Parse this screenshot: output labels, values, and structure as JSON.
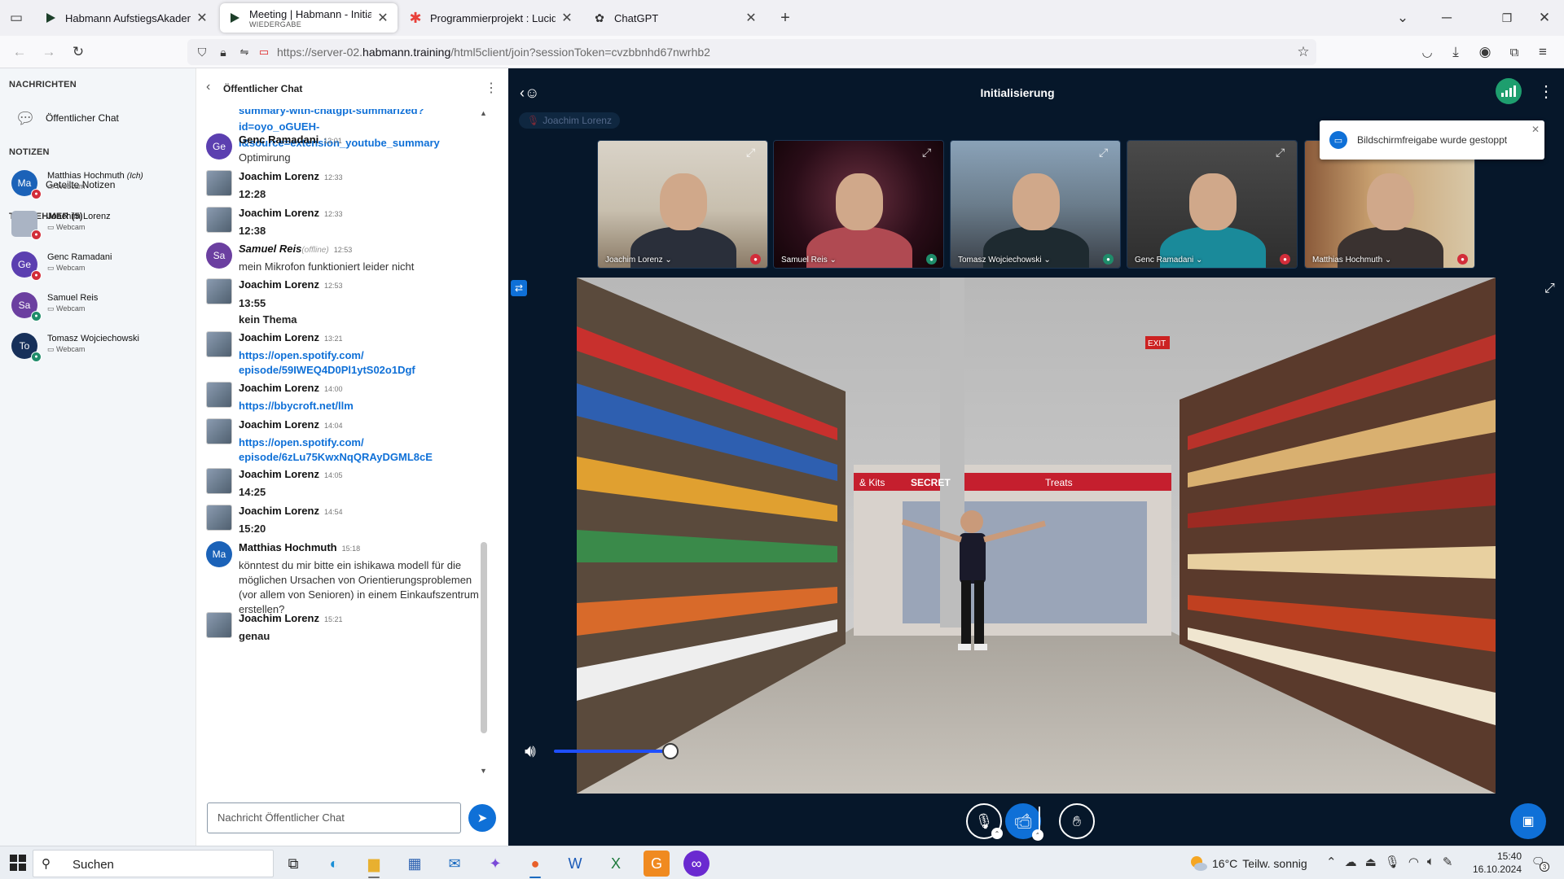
{
  "browser": {
    "tabs": [
      {
        "title": "Habmann AufstiegsAkademie",
        "subtitle": "",
        "icon": "habmann-play-icon",
        "active": false
      },
      {
        "title": "Meeting | Habmann - Initialisier",
        "subtitle": "WIEDERGABE",
        "icon": "habmann-play-icon",
        "active": true
      },
      {
        "title": "Programmierprojekt : Lucidspar",
        "subtitle": "",
        "icon": "lucid-star-icon",
        "active": false
      },
      {
        "title": "ChatGPT",
        "subtitle": "",
        "icon": "openai-icon",
        "active": false
      }
    ],
    "new_tab": "+",
    "url_prefix": "https://server-02.",
    "url_domain": "habmann.training",
    "url_path": "/html5client/join?sessionToken=cvzbbnhd67nwrhb2"
  },
  "left_panel": {
    "messages_heading": "NACHRICHTEN",
    "public_chat_label": "Öffentlicher Chat",
    "notes_heading": "NOTIZEN",
    "shared_notes_label": "Geteilte Notizen",
    "participants_heading": "TEILNEHMER (5)",
    "participants": [
      {
        "name": "Matthias Hochmuth",
        "tag": "(Ich)",
        "initials": "Ma",
        "role": "Webcam",
        "color": "#1b62b8",
        "mic": "muted",
        "photo": false
      },
      {
        "name": "Joachim Lorenz",
        "tag": "",
        "initials": "",
        "role": "Webcam",
        "color": "#aab4c4",
        "mic": "muted",
        "photo": true
      },
      {
        "name": "Genc Ramadani",
        "tag": "",
        "initials": "Ge",
        "role": "Webcam",
        "color": "#5b3fb0",
        "mic": "muted",
        "photo": false
      },
      {
        "name": "Samuel Reis",
        "tag": "",
        "initials": "Sa",
        "role": "Webcam",
        "color": "#6b3fa0",
        "mic": "on",
        "photo": false
      },
      {
        "name": "Tomasz Wojciechowski",
        "tag": "",
        "initials": "To",
        "role": "Webcam",
        "color": "#17305a",
        "mic": "on",
        "photo": false
      }
    ]
  },
  "chat": {
    "title": "Öffentlicher Chat",
    "partial_link": [
      "summary-with-chatgpt-summarized?",
      "id=oyo_oGUEH-",
      "I&source=extension_youtube_summary"
    ],
    "messages": [
      {
        "author": "Genc Ramadani",
        "initials": "Ge",
        "color": "#5b3fb0",
        "time": "12:01",
        "offline": "",
        "text": [
          "Optimirung"
        ],
        "link": false,
        "bold": false
      },
      {
        "author": "Joachim Lorenz",
        "initials": "",
        "color": "",
        "time": "12:33",
        "offline": "",
        "text": [
          "12:28"
        ],
        "link": false,
        "bold": true
      },
      {
        "author": "Joachim Lorenz",
        "initials": "",
        "color": "",
        "time": "12:33",
        "offline": "",
        "text": [
          "12:38"
        ],
        "link": false,
        "bold": true
      },
      {
        "author": "Samuel Reis",
        "initials": "Sa",
        "color": "#6b3fa0",
        "time": "12:53",
        "offline": "(offline)",
        "text": [
          "mein Mikrofon funktioniert leider nicht"
        ],
        "link": false,
        "bold": false
      },
      {
        "author": "Joachim Lorenz",
        "initials": "",
        "color": "",
        "time": "12:53",
        "offline": "",
        "text": [
          "13:55",
          "kein Thema"
        ],
        "link": false,
        "bold": true
      },
      {
        "author": "Joachim Lorenz",
        "initials": "",
        "color": "",
        "time": "13:21",
        "offline": "",
        "text": [
          "https://open.spotify.com/",
          "episode/59IWEQ4D0Pl1ytS02o1Dgf"
        ],
        "link": true,
        "bold": true
      },
      {
        "author": "Joachim Lorenz",
        "initials": "",
        "color": "",
        "time": "14:00",
        "offline": "",
        "text": [
          "https://bbycroft.net/llm"
        ],
        "link": true,
        "bold": true
      },
      {
        "author": "Joachim Lorenz",
        "initials": "",
        "color": "",
        "time": "14:04",
        "offline": "",
        "text": [
          "https://open.spotify.com/",
          "episode/6zLu75KwxNqQRAyDGML8cE"
        ],
        "link": true,
        "bold": true
      },
      {
        "author": "Joachim Lorenz",
        "initials": "",
        "color": "",
        "time": "14:05",
        "offline": "",
        "text": [
          "14:25"
        ],
        "link": false,
        "bold": true
      },
      {
        "author": "Joachim Lorenz",
        "initials": "",
        "color": "",
        "time": "14:54",
        "offline": "",
        "text": [
          "15:20"
        ],
        "link": false,
        "bold": true
      },
      {
        "author": "Matthias Hochmuth",
        "initials": "Ma",
        "color": "#1b62b8",
        "time": "15:18",
        "offline": "",
        "text": [
          "könntest du mir bitte ein ishikawa modell für die",
          "möglichen Ursachen von Orientierungsproblemen",
          "(vor allem von Senioren) in einem Einkaufszentrum",
          "erstellen?"
        ],
        "link": false,
        "bold": false
      },
      {
        "author": "Joachim Lorenz",
        "initials": "",
        "color": "",
        "time": "15:21",
        "offline": "",
        "text": [
          "genau"
        ],
        "link": false,
        "bold": true
      }
    ],
    "input_placeholder": "Nachricht Öffentlicher Chat"
  },
  "meeting": {
    "title": "Initialisierung",
    "talking_indicator": "Joachim Lorenz",
    "toast": "Bildschirmfreigabe wurde gestoppt",
    "webcams": [
      {
        "name": "Joachim Lorenz",
        "mic": "muted"
      },
      {
        "name": "Samuel Reis",
        "mic": "on"
      },
      {
        "name": "Tomasz Wojciechowski",
        "mic": "on"
      },
      {
        "name": "Genc Ramadani",
        "mic": "muted"
      },
      {
        "name": "Matthias Hochmuth",
        "mic": "muted"
      }
    ],
    "video_store_signs": [
      "& Kits",
      "SECRET",
      "Treats",
      "EXIT"
    ],
    "volume_level": 0.75
  },
  "taskbar": {
    "search_label": "Suchen",
    "weather_temp": "16°C",
    "weather_text": "Teilw. sonnig",
    "time": "15:40",
    "date": "16.10.2024",
    "notifications": "3"
  }
}
